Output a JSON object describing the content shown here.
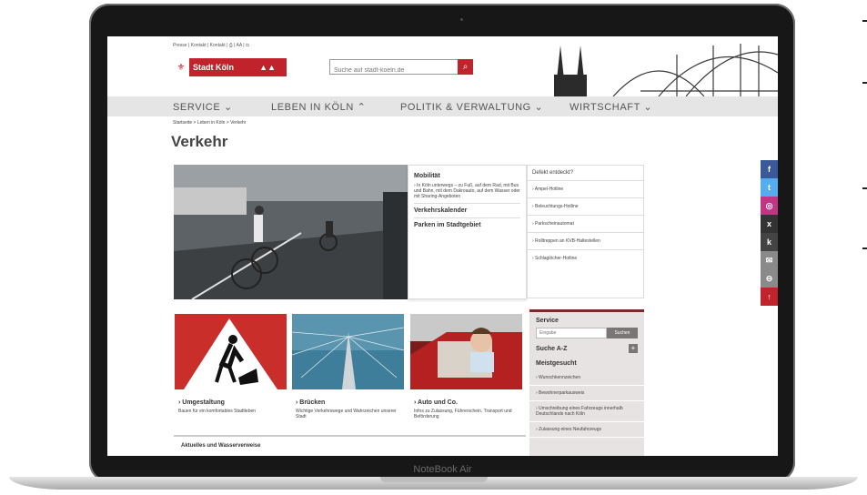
{
  "device": {
    "label": "NoteBook Air"
  },
  "header": {
    "utility_links": "Presse  |  Kontakt  |  Kontakt  |  ⎙  |  AA  |  ⇆",
    "logo_text": "Stadt Köln",
    "search": {
      "placeholder": "Suche auf stadt-koeln.de"
    }
  },
  "nav": {
    "items": [
      {
        "label": "SERVICE  ⌄"
      },
      {
        "label": "LEBEN IN KÖLN  ⌃"
      },
      {
        "label": "POLITIK & VERWALTUNG  ⌄"
      },
      {
        "label": "WIRTSCHAFT  ⌄"
      }
    ]
  },
  "breadcrumb": "Startseite  >  Leben in Köln  >  Verkehr",
  "page": {
    "title": "Verkehr"
  },
  "teaser": {
    "title": "Mobilität",
    "text": "› In Köln unterwegs – zu Fuß, auf dem Rad, mit Bus und Bahn, mit dem Dakroauto, auf dem Wasser oder mit Sharing-Angeboten",
    "link1": "Verkehrskalender",
    "link2": "Parken im Stadtgebiet"
  },
  "links_box": {
    "header": "Defekt entdeckt?",
    "items": [
      "› Ampel-Hotline",
      "› Beleuchtungs-Hotline",
      "› Parkscheinautomat",
      "› Rolltreppen an KVB-Haltestellen",
      "› Schlaglöcher-Hotline"
    ]
  },
  "cards": [
    {
      "title": "› Umgestaltung",
      "text": "Bauen für ein komfortables Stadtleben"
    },
    {
      "title": "› Brücken",
      "text": "Wichtige Verkehrswege und Wahrzeichen unserer Stadt"
    },
    {
      "title": "› Auto und Co.",
      "text": "Infos zu Zulassung, Führerschein, Transport und Beförderung"
    }
  ],
  "aktuell": "Aktuelles und Wasserverweise",
  "service": {
    "title": "Service",
    "search_placeholder": "Eingabe",
    "search_button": "Suchen",
    "az": "Suche A-Z",
    "plus": "+",
    "meistgesucht": "Meistgesucht",
    "items": [
      "› Wunschkennzeichen",
      "› Bewohnerparkausweis",
      "› Umschreibung eines Fahrzeugs innerhalb Deutschlands nach Köln",
      "› Zulassung eines Neufahrzeugs"
    ]
  },
  "social": [
    {
      "icon": "f",
      "color": "#3b5998"
    },
    {
      "icon": "t",
      "color": "#55acee"
    },
    {
      "icon": "◎",
      "color": "#c13584"
    },
    {
      "icon": "x",
      "color": "#333333"
    },
    {
      "icon": "k",
      "color": "#444444"
    },
    {
      "icon": "✉",
      "color": "#8a8a8a"
    },
    {
      "icon": "⊖",
      "color": "#8a8a8a"
    },
    {
      "icon": "↑",
      "color": "#c0232b"
    }
  ]
}
